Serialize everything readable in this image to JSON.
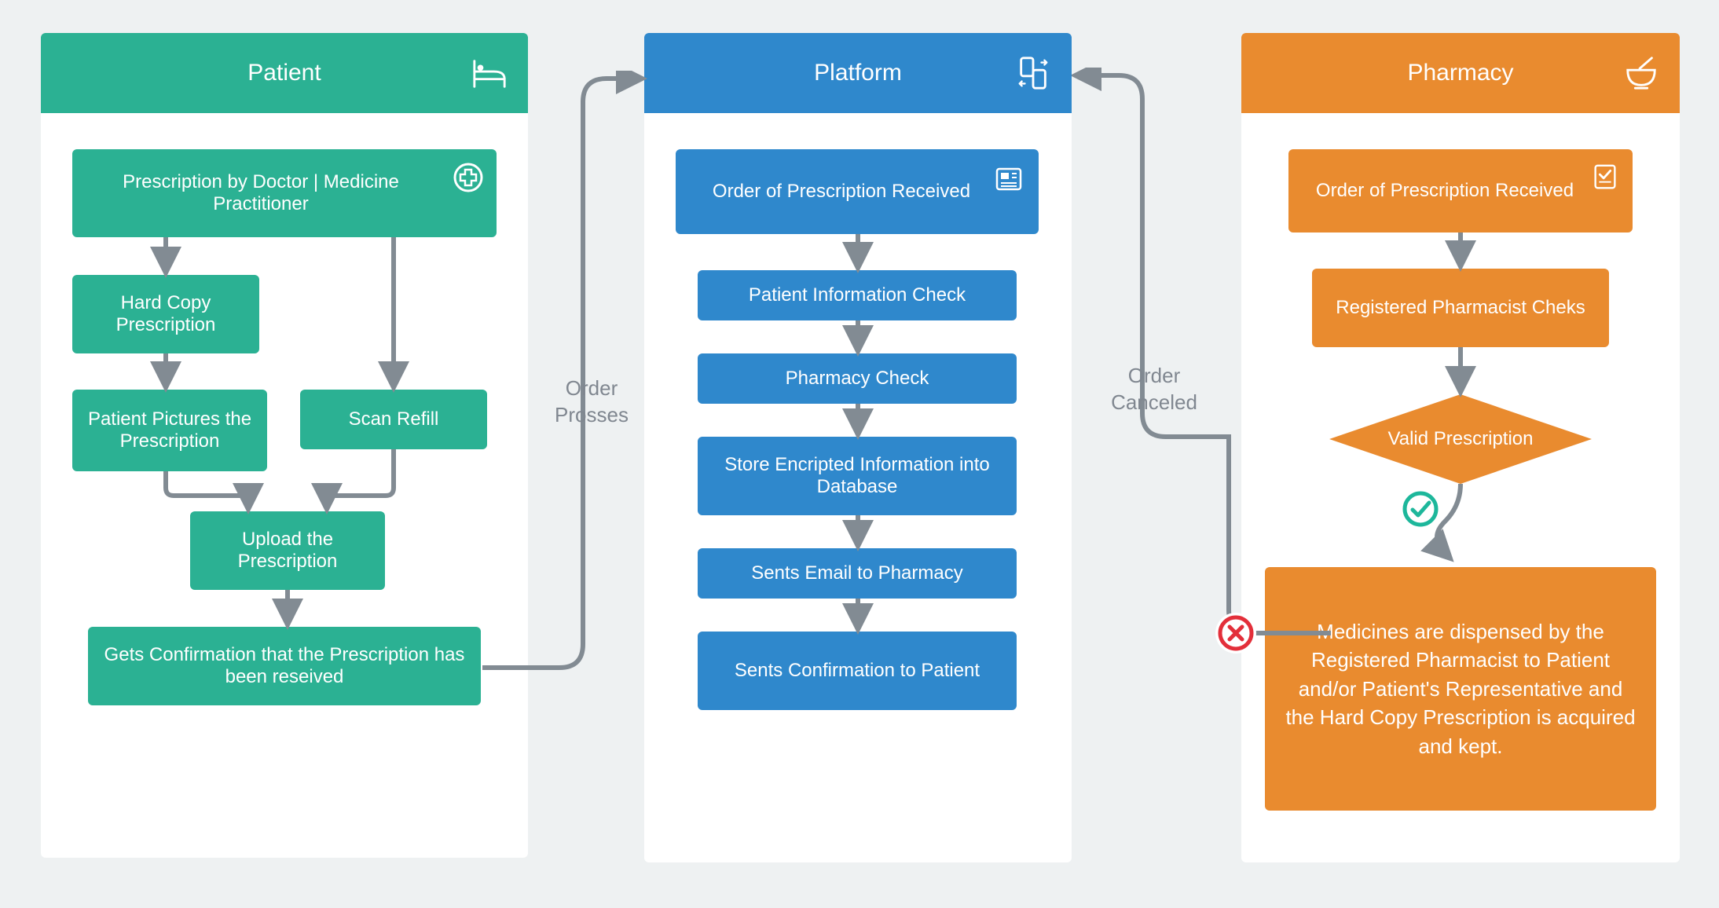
{
  "patient": {
    "header": "Patient",
    "prescription": "Prescription by Doctor | Medicine Practitioner",
    "hardcopy": "Hard Copy Prescription",
    "pictures": "Patient Pictures the Prescription",
    "scan_refill": "Scan Refill",
    "upload": "Upload the Prescription",
    "confirmation": "Gets Confirmation that the Prescription has been reseived"
  },
  "platform": {
    "header": "Platform",
    "received": "Order of Prescription Received",
    "info_check": "Patient Information Check",
    "pharmacy_check": "Pharmacy Check",
    "store": "Store Encripted Information into Database",
    "email": "Sents Email to Pharmacy",
    "confirm": "Sents Confirmation to Patient"
  },
  "pharmacy": {
    "header": "Pharmacy",
    "received": "Order of Prescription Received",
    "checks": "Registered Pharmacist Cheks",
    "valid": "Valid Prescription",
    "dispensed": "Medicines are dispensed by the Registered Pharmacist to Patient and/or Patient's Representative and the Hard Copy Prescription is acquired and kept."
  },
  "edges": {
    "order_prosses": "Order Prosses",
    "order_canceled": "Order Canceled"
  }
}
